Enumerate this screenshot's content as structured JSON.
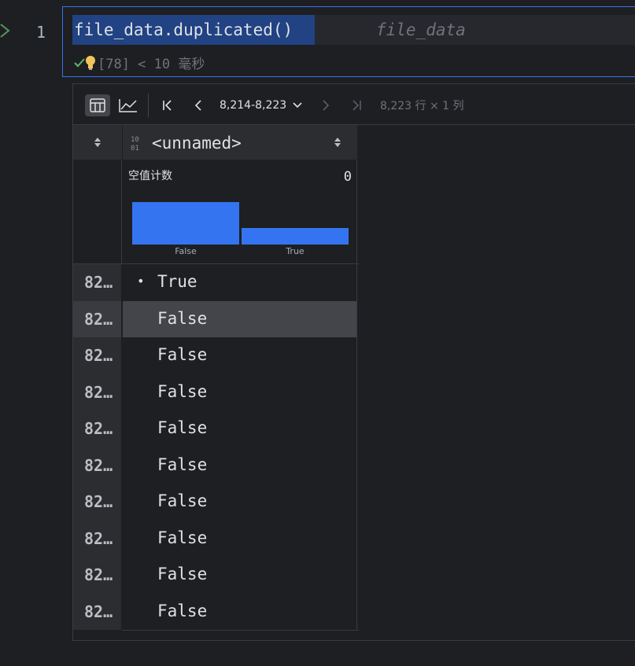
{
  "cell": {
    "line_number": "1",
    "code": "file_data.duplicated()",
    "inline_hint": "file_data",
    "status": "[78] < 10 毫秒"
  },
  "toolbar": {
    "range_label": "8,214-8,223",
    "info": "8,223 行 × 1 列",
    "icons": [
      "table-icon",
      "chart-icon",
      "first-page-icon",
      "prev-page-icon",
      "chevron-down-icon",
      "next-page-icon",
      "last-page-icon"
    ]
  },
  "grid": {
    "column_name": "<unnamed>",
    "stats": {
      "label": "空值计数",
      "value": "0",
      "histogram": [
        {
          "label": "False",
          "fraction": 1.0
        },
        {
          "label": "True",
          "fraction": 0.38
        }
      ]
    },
    "rows": [
      {
        "index": "82…",
        "value": "True",
        "bullet": "•"
      },
      {
        "index": "82…",
        "value": "False",
        "selected": true
      },
      {
        "index": "82…",
        "value": "False"
      },
      {
        "index": "82…",
        "value": "False"
      },
      {
        "index": "82…",
        "value": "False"
      },
      {
        "index": "82…",
        "value": "False"
      },
      {
        "index": "82…",
        "value": "False"
      },
      {
        "index": "82…",
        "value": "False"
      },
      {
        "index": "82…",
        "value": "False"
      },
      {
        "index": "82…",
        "value": "False"
      }
    ]
  },
  "colors": {
    "accent": "#3574f0",
    "selection": "#214283",
    "background": "#1e1f22"
  }
}
